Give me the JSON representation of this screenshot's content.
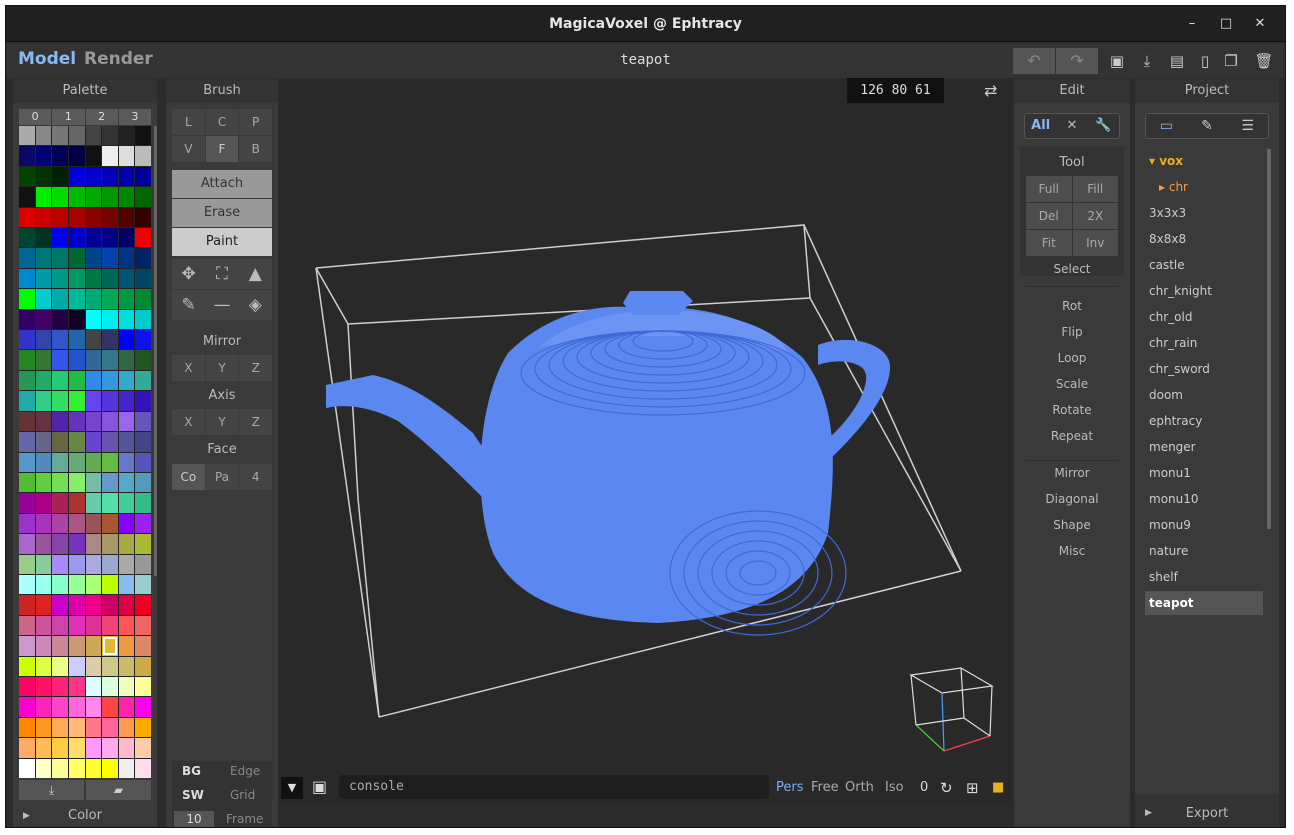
{
  "window": {
    "title": "MagicaVoxel @ Ephtracy",
    "min": "–",
    "max": "□",
    "close": "✕"
  },
  "menubar": {
    "model": "Model",
    "render": "Render",
    "document": "teapot",
    "undo": "↶",
    "redo": "↷",
    "icons": [
      "save-icon",
      "import-icon",
      "open-folder-icon",
      "new-file-icon",
      "copy-icon",
      "delete-icon"
    ],
    "glyphs": [
      "▣",
      "⤓",
      "▤",
      "▯",
      "❐",
      "🗑"
    ]
  },
  "palette": {
    "title": "Palette",
    "columns": [
      "0",
      "1",
      "2",
      "3"
    ],
    "selected_index": 205,
    "colors": [
      "#aaaaaa",
      "#888888",
      "#777777",
      "#666666",
      "#444444",
      "#333333",
      "#222222",
      "#111111",
      "#0a0a66",
      "#000077",
      "#000055",
      "#000044",
      "#111111",
      "#eeeeee",
      "#dddddd",
      "#bbbbbb",
      "#004400",
      "#003300",
      "#002200",
      "#0000dd",
      "#0000cc",
      "#0000bb",
      "#0000aa",
      "#000099",
      "#111111",
      "#00ee00",
      "#00dd00",
      "#00bb00",
      "#00aa00",
      "#009900",
      "#008800",
      "#006600",
      "#dd0000",
      "#cc0000",
      "#bb0000",
      "#aa0000",
      "#880000",
      "#770000",
      "#550000",
      "#330000",
      "#004433",
      "#003322",
      "#0000ee",
      "#0000cc",
      "#000099",
      "#000088",
      "#000066",
      "#ee0000",
      "#006699",
      "#007777",
      "#007766",
      "#006633",
      "#004488",
      "#0044aa",
      "#003388",
      "#002266",
      "#0088cc",
      "#0099aa",
      "#009988",
      "#009966",
      "#007744",
      "#006655",
      "#005577",
      "#004466",
      "#00ff00",
      "#00cccc",
      "#00aaaa",
      "#00bb99",
      "#00aa77",
      "#00aa55",
      "#009944",
      "#008833",
      "#330066",
      "#440066",
      "#220044",
      "#110022",
      "#00ffff",
      "#00eeee",
      "#00dddd",
      "#00cccc",
      "#3333cc",
      "#3344aa",
      "#3355cc",
      "#2266aa",
      "#444444",
      "#333366",
      "#0000ff",
      "#1111ee",
      "#228822",
      "#337733",
      "#3355ee",
      "#2255cc",
      "#336699",
      "#337788",
      "#336644",
      "#225522",
      "#229955",
      "#22aa66",
      "#22cc77",
      "#22bb44",
      "#3388ee",
      "#3399dd",
      "#33aacc",
      "#33aa99",
      "#22aaaa",
      "#33cc88",
      "#33dd66",
      "#33ee33",
      "#6644ee",
      "#5533dd",
      "#4422cc",
      "#3311bb",
      "#663333",
      "#663344",
      "#5522aa",
      "#6633bb",
      "#7744cc",
      "#8855dd",
      "#9966ee",
      "#6655bb",
      "#6666aa",
      "#666688",
      "#666644",
      "#668844",
      "#6644cc",
      "#6655aa",
      "#555599",
      "#444488",
      "#5599cc",
      "#5588bb",
      "#66aa99",
      "#66aa77",
      "#66aa55",
      "#66bb44",
      "#6677cc",
      "#5555bb",
      "#55bb33",
      "#66cc44",
      "#77dd55",
      "#88ee66",
      "#77bbaa",
      "#6699cc",
      "#55aacc",
      "#5599bb",
      "#990099",
      "#aa0088",
      "#aa2255",
      "#aa3333",
      "#66ccaa",
      "#55ddaa",
      "#44cc99",
      "#33bb88",
      "#9933cc",
      "#aa33bb",
      "#aa44aa",
      "#aa5588",
      "#995555",
      "#aa5533",
      "#8800ff",
      "#9922ee",
      "#aa66cc",
      "#995599",
      "#8844aa",
      "#7733bb",
      "#aa8888",
      "#aa9966",
      "#aaaa44",
      "#aabb33",
      "#99cc88",
      "#88cc99",
      "#aa88ff",
      "#9999ee",
      "#aaaadd",
      "#99aacc",
      "#aaaaaa",
      "#999999",
      "#aaffff",
      "#99ffee",
      "#88ffcc",
      "#99ff99",
      "#aaff77",
      "#bbff00",
      "#88bbee",
      "#99cccc",
      "#cc2222",
      "#dd2222",
      "#cc00cc",
      "#dd00aa",
      "#ee0088",
      "#cc0066",
      "#dd0044",
      "#ee0022",
      "#cc6688",
      "#cc5599",
      "#cc44aa",
      "#dd33bb",
      "#dd3399",
      "#ee4477",
      "#ff5555",
      "#ee6666",
      "#cc99cc",
      "#cc88bb",
      "#cc8899",
      "#cc9977",
      "#ccaa55",
      "#ddbb33",
      "#ee9944",
      "#dd8866",
      "#ccff00",
      "#ddff44",
      "#eeff88",
      "#ccccff",
      "#ddccaa",
      "#cccc88",
      "#ccbb66",
      "#ccaa44",
      "#ff0066",
      "#ff1166",
      "#ff2277",
      "#ff3388",
      "#ddffff",
      "#ddffdd",
      "#eeffbb",
      "#ffff99",
      "#ff00cc",
      "#ff22bb",
      "#ff44cc",
      "#ff66dd",
      "#ff88ee",
      "#ff4444",
      "#ff22aa",
      "#ff00ee",
      "#ff8800",
      "#ff9922",
      "#ffaa55",
      "#ffbb77",
      "#ff7788",
      "#ff6699",
      "#ff9955",
      "#ffaa00",
      "#ffaa66",
      "#ffbb55",
      "#ffcc44",
      "#ffdd66",
      "#ff99ff",
      "#ffaaee",
      "#ffbbcc",
      "#ffccaa",
      "#ffffff",
      "#ffffcc",
      "#ffff99",
      "#ffff66",
      "#ffff33",
      "#ffff00",
      "#eeeeee",
      "#ffddee"
    ],
    "import_icon": "⤓",
    "folder_icon": "▰",
    "color_label": "Color"
  },
  "brush": {
    "title": "Brush",
    "row1": [
      "L",
      "C",
      "P"
    ],
    "row2": [
      "V",
      "F",
      "B"
    ],
    "actions": [
      "Attach",
      "Erase",
      "Paint"
    ],
    "tool_glyphs": [
      "✥",
      "⛶",
      "▲",
      "✎",
      "—",
      "◈"
    ],
    "mirror": "Mirror",
    "axis": "Axis",
    "face": "Face",
    "xyz": [
      "X",
      "Y",
      "Z"
    ],
    "face_opts": [
      "Co",
      "Pa",
      "4"
    ],
    "bg": "BG",
    "edge": "Edge",
    "sw": "SW",
    "grid": "Grid",
    "frame_val": "10",
    "frame": "Frame"
  },
  "viewport": {
    "coords": "126  80  61",
    "swap": "⇄",
    "voxel_color": "#5b87f0",
    "console": "console",
    "view_modes": [
      "Pers",
      "Free",
      "Orth",
      "Iso"
    ],
    "active_view": "Pers",
    "zero": "0",
    "bottom_glyphs": [
      "↻",
      "⊞",
      "■"
    ]
  },
  "edit": {
    "title": "Edit",
    "select_tabs": [
      "All",
      "✕",
      "🔧"
    ],
    "tool_title": "Tool",
    "tool_buttons": [
      [
        "Full",
        "Fill"
      ],
      [
        "Del",
        "2X"
      ],
      [
        "Fit",
        "Inv"
      ]
    ],
    "select": "Select",
    "group1": [
      "Rot",
      "Flip",
      "Loop",
      "Scale",
      "Rotate",
      "Repeat"
    ],
    "group2": [
      "Mirror",
      "Diagonal",
      "Shape",
      "Misc"
    ]
  },
  "project": {
    "title": "Project",
    "tab_glyphs": [
      "▭",
      "✎",
      "☰"
    ],
    "items": [
      "vox",
      "chr",
      "3x3x3",
      "8x8x8",
      "castle",
      "chr_knight",
      "chr_old",
      "chr_rain",
      "chr_sword",
      "doom",
      "ephtracy",
      "menger",
      "monu1",
      "monu10",
      "monu9",
      "nature",
      "shelf",
      "teapot"
    ],
    "selected": "teapot",
    "export": "Export"
  }
}
